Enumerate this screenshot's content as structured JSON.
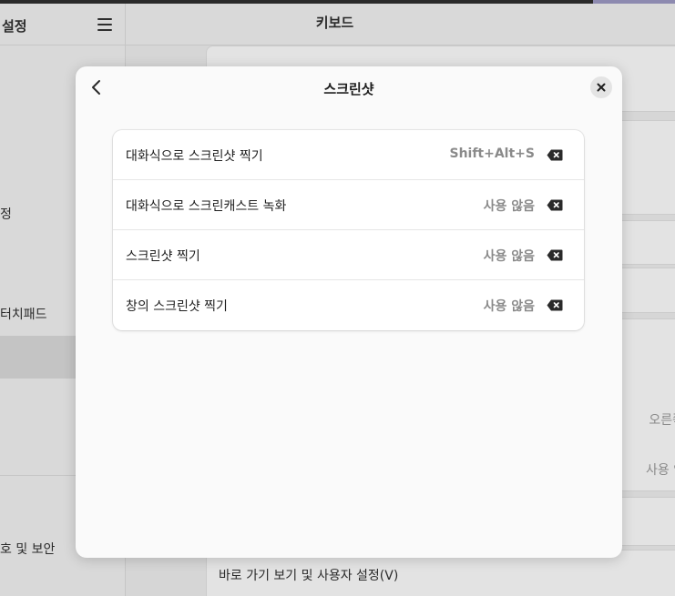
{
  "background": {
    "sidebar": {
      "title": "설정",
      "items": [
        "정",
        "터치패드",
        "호 및 보안"
      ]
    },
    "main": {
      "title": "키보드",
      "values": [
        "오른쪽 A",
        "사용 않음"
      ],
      "bottom_row_label": "바로 가기 보기 및 사용자 설정(V)"
    }
  },
  "dialog": {
    "title": "스크린샷",
    "shortcuts": [
      {
        "label": "대화식으로 스크린샷 찍기",
        "accelerator": "Shift+Alt+S"
      },
      {
        "label": "대화식으로 스크린캐스트 녹화",
        "accelerator": "사용 않음"
      },
      {
        "label": "스크린샷 찍기",
        "accelerator": "사용 않음"
      },
      {
        "label": "창의 스크린샷 찍기",
        "accelerator": "사용 않음"
      }
    ]
  },
  "icons": {
    "menu": "hamburger-menu-icon",
    "back": "chevron-left-icon",
    "close": "close-icon",
    "clear": "backspace-clear-icon"
  },
  "colors": {
    "dialog_bg": "#fafafa",
    "secondary_text": "#8a8a8a",
    "selected_sidebar": "#c4c4c4"
  }
}
